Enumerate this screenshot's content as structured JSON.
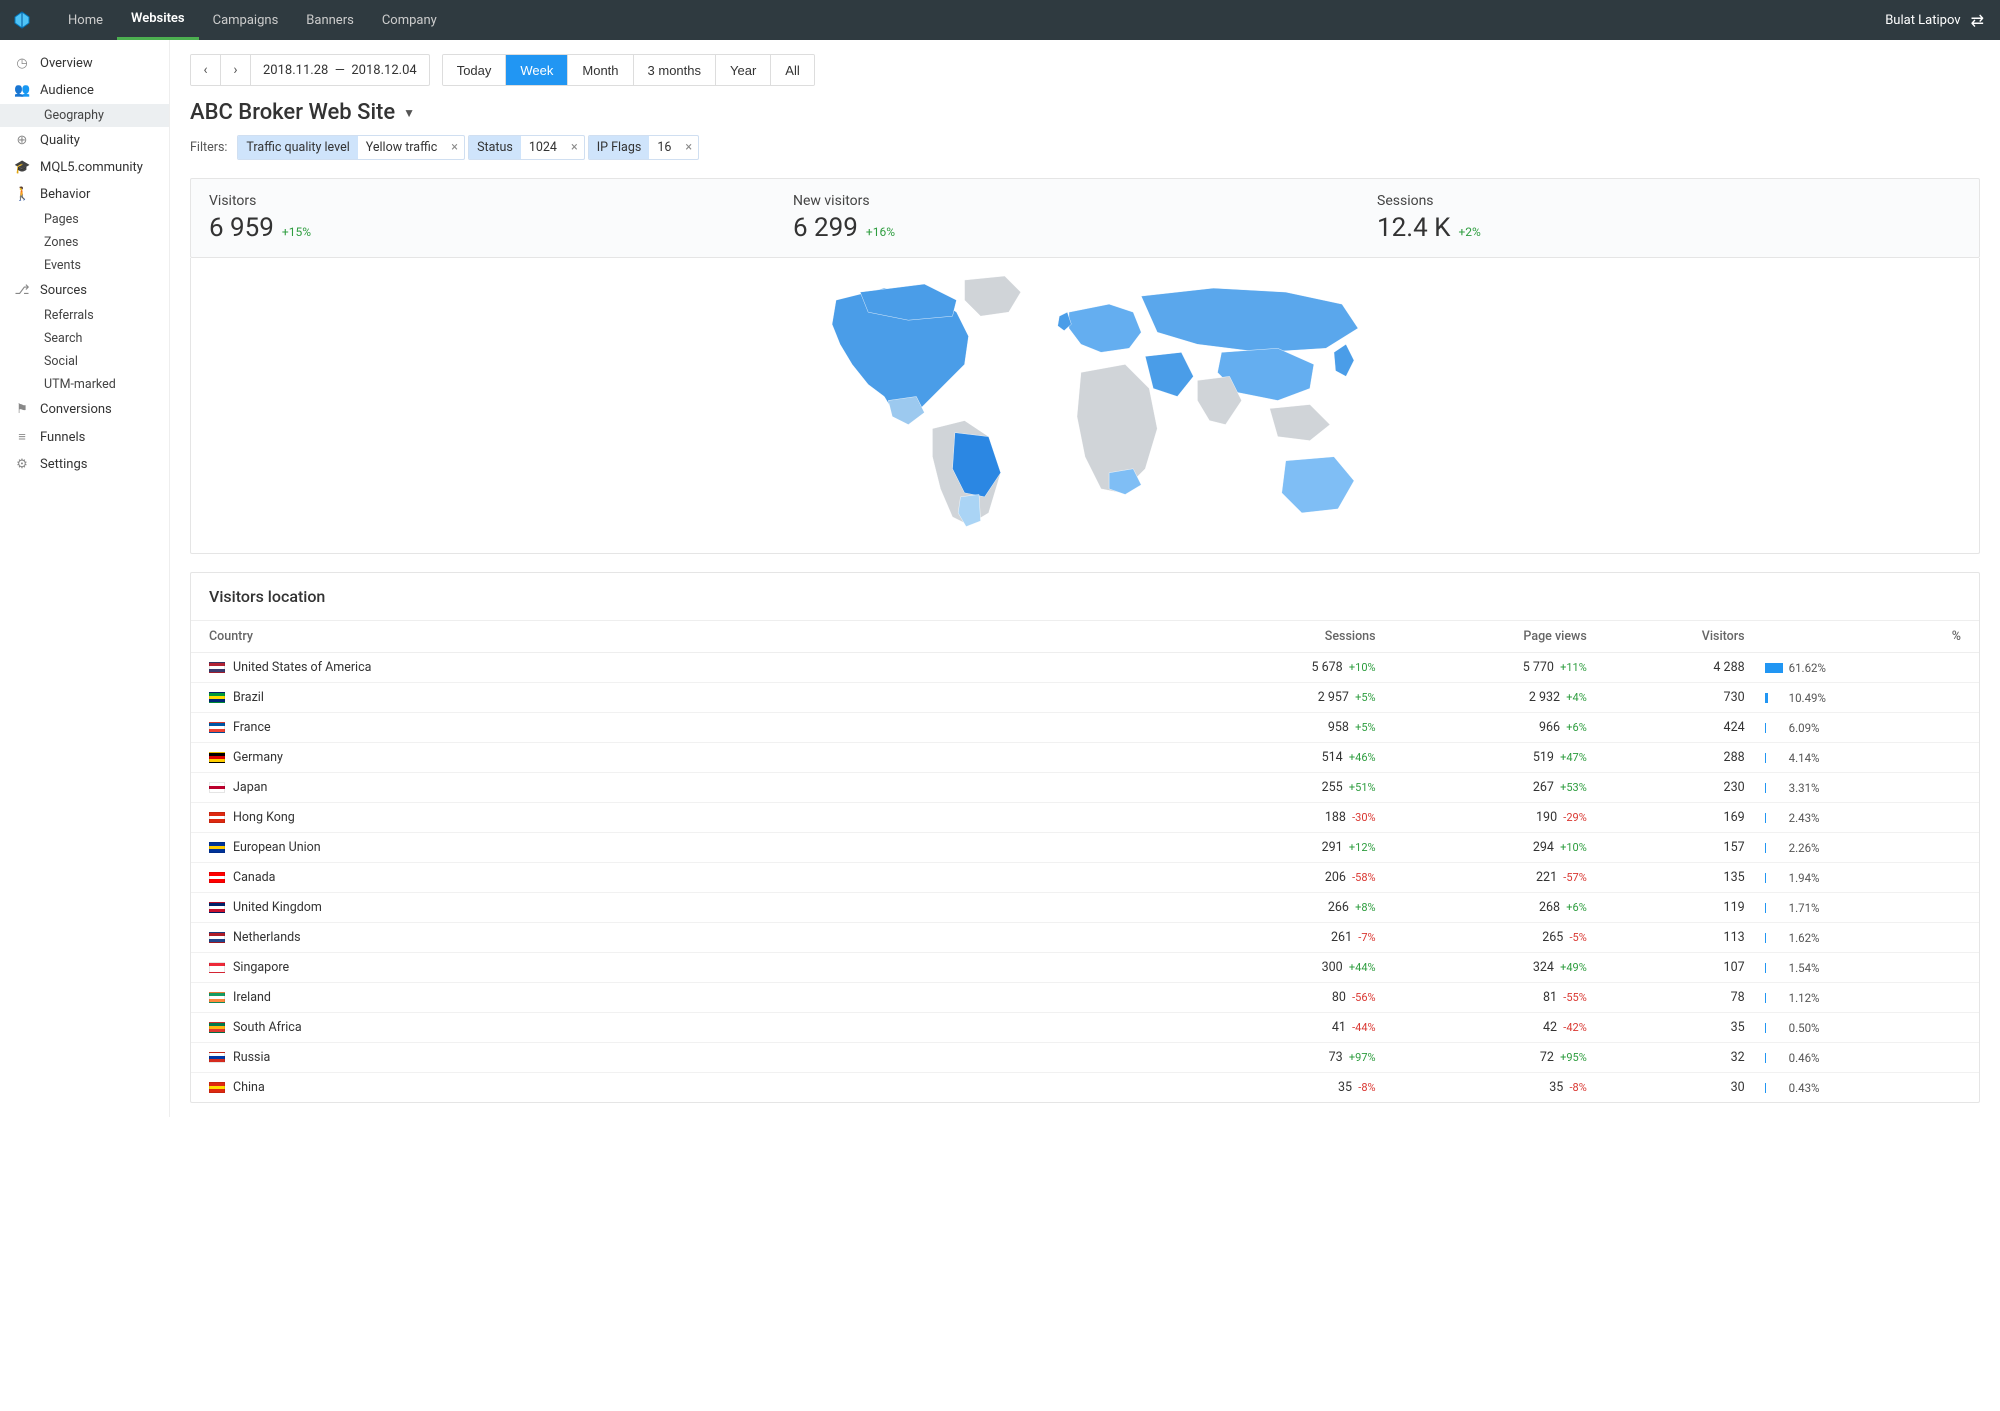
{
  "topnav": {
    "items": [
      "Home",
      "Websites",
      "Campaigns",
      "Banners",
      "Company"
    ],
    "active_index": 1,
    "user": "Bulat Latipov"
  },
  "sidebar": {
    "items": [
      {
        "label": "Overview",
        "icon": "overview-icon"
      },
      {
        "label": "Audience",
        "icon": "audience-icon",
        "children": [
          {
            "label": "Geography",
            "active": true
          }
        ]
      },
      {
        "label": "Quality",
        "icon": "quality-icon"
      },
      {
        "label": "MQL5.community",
        "icon": "mql5-icon"
      },
      {
        "label": "Behavior",
        "icon": "behavior-icon",
        "children": [
          {
            "label": "Pages"
          },
          {
            "label": "Zones"
          },
          {
            "label": "Events"
          }
        ]
      },
      {
        "label": "Sources",
        "icon": "sources-icon",
        "children": [
          {
            "label": "Referrals"
          },
          {
            "label": "Search"
          },
          {
            "label": "Social"
          },
          {
            "label": "UTM-marked"
          }
        ]
      },
      {
        "label": "Conversions",
        "icon": "conversions-icon"
      },
      {
        "label": "Funnels",
        "icon": "funnels-icon"
      },
      {
        "label": "Settings",
        "icon": "settings-icon"
      }
    ]
  },
  "date_range": {
    "from": "2018.11.28",
    "to": "2018.12.04"
  },
  "periods": [
    "Today",
    "Week",
    "Month",
    "3 months",
    "Year",
    "All"
  ],
  "periods_active_index": 1,
  "site_title": "ABC Broker Web Site",
  "filters": {
    "label": "Filters:",
    "chips": [
      {
        "key": "Traffic quality level",
        "value": "Yellow traffic"
      },
      {
        "key": "Status",
        "value": "1024"
      },
      {
        "key": "IP Flags",
        "value": "16"
      }
    ]
  },
  "stats": [
    {
      "label": "Visitors",
      "value": "6 959",
      "delta": "+15%",
      "dir": "pos"
    },
    {
      "label": "New visitors",
      "value": "6 299",
      "delta": "+16%",
      "dir": "pos"
    },
    {
      "label": "Sessions",
      "value": "12.4 K",
      "delta": "+2%",
      "dir": "pos"
    }
  ],
  "table": {
    "title": "Visitors location",
    "columns": [
      "Country",
      "Sessions",
      "Page views",
      "Visitors",
      "%"
    ],
    "rows": [
      {
        "flag": "us",
        "country": "United States of America",
        "sessions": "5 678",
        "sessions_d": "+10%",
        "sd": "pos",
        "pv": "5 770",
        "pv_d": "+11%",
        "pd": "pos",
        "visitors": "4 288",
        "pct": "61.62%",
        "bar": 61.62
      },
      {
        "flag": "br",
        "country": "Brazil",
        "sessions": "2 957",
        "sessions_d": "+5%",
        "sd": "pos",
        "pv": "2 932",
        "pv_d": "+4%",
        "pd": "pos",
        "visitors": "730",
        "pct": "10.49%",
        "bar": 10.49
      },
      {
        "flag": "fr",
        "country": "France",
        "sessions": "958",
        "sessions_d": "+5%",
        "sd": "pos",
        "pv": "966",
        "pv_d": "+6%",
        "pd": "pos",
        "visitors": "424",
        "pct": "6.09%",
        "bar": 6.09
      },
      {
        "flag": "de",
        "country": "Germany",
        "sessions": "514",
        "sessions_d": "+46%",
        "sd": "pos",
        "pv": "519",
        "pv_d": "+47%",
        "pd": "pos",
        "visitors": "288",
        "pct": "4.14%",
        "bar": 4.14
      },
      {
        "flag": "jp",
        "country": "Japan",
        "sessions": "255",
        "sessions_d": "+51%",
        "sd": "pos",
        "pv": "267",
        "pv_d": "+53%",
        "pd": "pos",
        "visitors": "230",
        "pct": "3.31%",
        "bar": 3.31
      },
      {
        "flag": "hk",
        "country": "Hong Kong",
        "sessions": "188",
        "sessions_d": "-30%",
        "sd": "neg",
        "pv": "190",
        "pv_d": "-29%",
        "pd": "neg",
        "visitors": "169",
        "pct": "2.43%",
        "bar": 2.43
      },
      {
        "flag": "eu",
        "country": "European Union",
        "sessions": "291",
        "sessions_d": "+12%",
        "sd": "pos",
        "pv": "294",
        "pv_d": "+10%",
        "pd": "pos",
        "visitors": "157",
        "pct": "2.26%",
        "bar": 2.26
      },
      {
        "flag": "ca",
        "country": "Canada",
        "sessions": "206",
        "sessions_d": "-58%",
        "sd": "neg",
        "pv": "221",
        "pv_d": "-57%",
        "pd": "neg",
        "visitors": "135",
        "pct": "1.94%",
        "bar": 1.94
      },
      {
        "flag": "gb",
        "country": "United Kingdom",
        "sessions": "266",
        "sessions_d": "+8%",
        "sd": "pos",
        "pv": "268",
        "pv_d": "+6%",
        "pd": "pos",
        "visitors": "119",
        "pct": "1.71%",
        "bar": 1.71
      },
      {
        "flag": "nl",
        "country": "Netherlands",
        "sessions": "261",
        "sessions_d": "-7%",
        "sd": "neg",
        "pv": "265",
        "pv_d": "-5%",
        "pd": "neg",
        "visitors": "113",
        "pct": "1.62%",
        "bar": 1.62
      },
      {
        "flag": "sg",
        "country": "Singapore",
        "sessions": "300",
        "sessions_d": "+44%",
        "sd": "pos",
        "pv": "324",
        "pv_d": "+49%",
        "pd": "pos",
        "visitors": "107",
        "pct": "1.54%",
        "bar": 1.54
      },
      {
        "flag": "ie",
        "country": "Ireland",
        "sessions": "80",
        "sessions_d": "-56%",
        "sd": "neg",
        "pv": "81",
        "pv_d": "-55%",
        "pd": "neg",
        "visitors": "78",
        "pct": "1.12%",
        "bar": 1.12
      },
      {
        "flag": "za",
        "country": "South Africa",
        "sessions": "41",
        "sessions_d": "-44%",
        "sd": "neg",
        "pv": "42",
        "pv_d": "-42%",
        "pd": "neg",
        "visitors": "35",
        "pct": "0.50%",
        "bar": 0.5
      },
      {
        "flag": "ru",
        "country": "Russia",
        "sessions": "73",
        "sessions_d": "+97%",
        "sd": "pos",
        "pv": "72",
        "pv_d": "+95%",
        "pd": "pos",
        "visitors": "32",
        "pct": "0.46%",
        "bar": 0.46
      },
      {
        "flag": "cn",
        "country": "China",
        "sessions": "35",
        "sessions_d": "-8%",
        "sd": "neg",
        "pv": "35",
        "pv_d": "-8%",
        "pd": "neg",
        "visitors": "30",
        "pct": "0.43%",
        "bar": 0.43
      }
    ]
  },
  "flag_colors": {
    "us": [
      "#b22234",
      "#ffffff",
      "#3c3b6e"
    ],
    "br": [
      "#009b3a",
      "#fedf00",
      "#002776"
    ],
    "fr": [
      "#0055a4",
      "#ffffff",
      "#ef4135"
    ],
    "de": [
      "#000000",
      "#dd0000",
      "#ffce00"
    ],
    "jp": [
      "#ffffff",
      "#bc002d",
      "#ffffff"
    ],
    "hk": [
      "#de2910",
      "#ffffff",
      "#de2910"
    ],
    "eu": [
      "#003399",
      "#ffcc00",
      "#003399"
    ],
    "ca": [
      "#ff0000",
      "#ffffff",
      "#ff0000"
    ],
    "gb": [
      "#012169",
      "#ffffff",
      "#c8102e"
    ],
    "nl": [
      "#ae1c28",
      "#ffffff",
      "#21468b"
    ],
    "sg": [
      "#ed2939",
      "#ffffff",
      "#ffffff"
    ],
    "ie": [
      "#169b62",
      "#ffffff",
      "#ff883e"
    ],
    "za": [
      "#007a4d",
      "#ffb612",
      "#de3831"
    ],
    "ru": [
      "#ffffff",
      "#0039a6",
      "#d52b1e"
    ],
    "cn": [
      "#de2910",
      "#ffde00",
      "#de2910"
    ]
  },
  "icon_glyphs": {
    "overview-icon": "◷",
    "audience-icon": "👥",
    "quality-icon": "⊕",
    "mql5-icon": "🎓",
    "behavior-icon": "🚶",
    "sources-icon": "⎇",
    "conversions-icon": "⚑",
    "funnels-icon": "≡",
    "settings-icon": "⚙"
  }
}
